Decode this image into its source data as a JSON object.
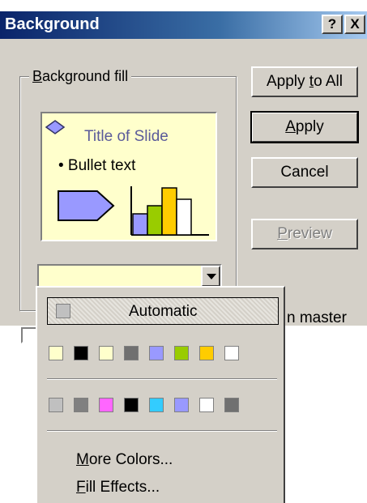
{
  "dialog": {
    "title": "Background",
    "help_label": "?",
    "close_label": "X"
  },
  "group": {
    "label": "Background fill"
  },
  "preview": {
    "slide_title": "Title of Slide",
    "bullet_text": "• Bullet text"
  },
  "buttons": {
    "apply_to_all": "Apply to All",
    "apply": "Apply",
    "cancel": "Cancel",
    "preview": "Preview"
  },
  "checkbox": {
    "label_visible": "n master"
  },
  "dropdown": {
    "automatic_label": "Automatic",
    "row1_colors": [
      "#ffffcc",
      "#000000",
      "#ffffcc",
      "#707070",
      "#9999ff",
      "#99cc00",
      "#ffcc00",
      "#ffffff"
    ],
    "row2_colors": [
      "#c0c0c0",
      "#808080",
      "#ff66ff",
      "#000000",
      "#33ccff",
      "#9999ff",
      "#ffffff",
      "#707070"
    ],
    "more_colors": "More Colors...",
    "fill_effects": "Fill Effects..."
  }
}
